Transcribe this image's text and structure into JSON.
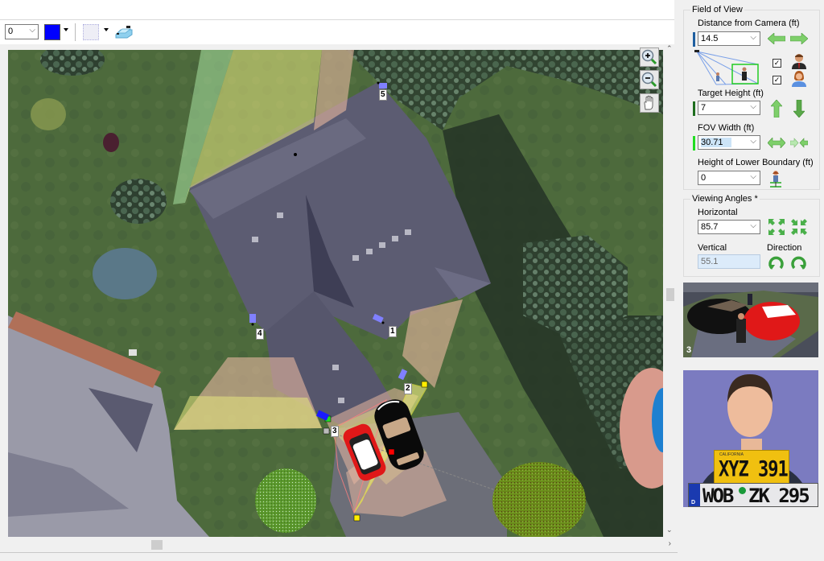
{
  "toolbar": {
    "line_width_value": "0",
    "color": "#0000ff",
    "icons": [
      "line-width-combo",
      "color-picker-icon",
      "grid-pattern-icon",
      "layer-icon"
    ]
  },
  "map": {
    "zoom_in_label": "zoom-in",
    "zoom_out_label": "zoom-out",
    "pan_label": "pan",
    "cameras": [
      {
        "id": "1",
        "label": "1"
      },
      {
        "id": "2",
        "label": "2"
      },
      {
        "id": "3",
        "label": "3"
      },
      {
        "id": "4",
        "label": "4"
      },
      {
        "id": "5",
        "label": "5"
      }
    ]
  },
  "panel": {
    "fov_group_title": "Field of View",
    "distance_label": "Distance from Camera  (ft)",
    "distance_value": "14.5",
    "target_height_label": "Target Height (ft)",
    "target_height_value": "7",
    "fov_width_label": "FOV Width (ft)",
    "fov_width_value": "30.71",
    "lower_boundary_label": "Height of Lower Boundary (ft)",
    "lower_boundary_value": "0",
    "male_checkbox": "✓",
    "female_checkbox": "✓",
    "angles_group_title": "Viewing Angles *",
    "horizontal_label": "Horizontal",
    "horizontal_value": "85.7",
    "vertical_label": "Vertical",
    "vertical_value": "55.1",
    "direction_label": "Direction",
    "preview_camera_number": "3",
    "plate1_state": "CALIFORNIA",
    "plate1_text": "XYZ 391",
    "plate2_text_left": "WOB",
    "plate2_text_right": "ZK 295",
    "plate2_country": "D"
  },
  "colors": {
    "accent_blue": "#0000ff",
    "marker_distance": "#1f5fa0",
    "marker_target": "#1e6e1e",
    "marker_fov": "#22dd22",
    "fov_face": "#e8b8a0",
    "fov_yellow": "#e8e880",
    "fov_green": "#a8e0a0"
  }
}
